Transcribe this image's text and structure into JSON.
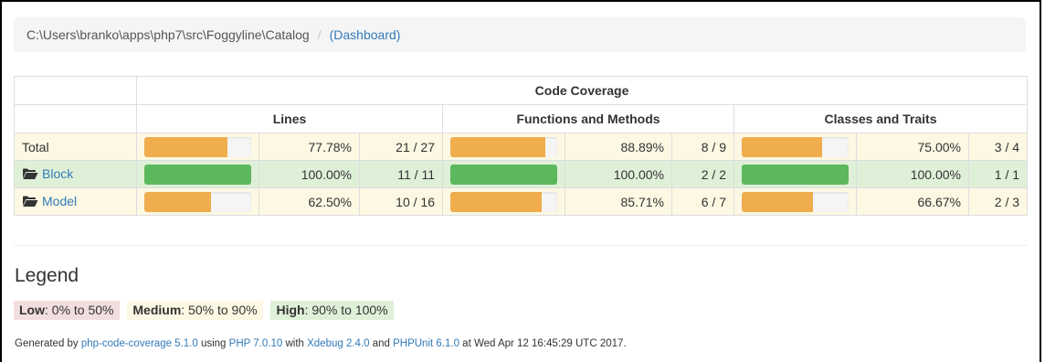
{
  "breadcrumb": {
    "path": "C:\\Users\\branko\\apps\\php7\\src\\Foggyline\\Catalog",
    "separator": "/",
    "dashboard_link": "(Dashboard)"
  },
  "table": {
    "title": "Code Coverage",
    "groups": [
      "Lines",
      "Functions and Methods",
      "Classes and Traits"
    ],
    "rows": [
      {
        "name": "Total",
        "is_link": false,
        "status": "warning",
        "lines": {
          "fraction": 0.7778,
          "percent": "77.78%",
          "count": "21 / 27",
          "level": "warning"
        },
        "functions": {
          "fraction": 0.8889,
          "percent": "88.89%",
          "count": "8 / 9",
          "level": "warning"
        },
        "classes": {
          "fraction": 0.75,
          "percent": "75.00%",
          "count": "3 / 4",
          "level": "warning"
        }
      },
      {
        "name": "Block",
        "is_link": true,
        "status": "success",
        "lines": {
          "fraction": 1.0,
          "percent": "100.00%",
          "count": "11 / 11",
          "level": "success"
        },
        "functions": {
          "fraction": 1.0,
          "percent": "100.00%",
          "count": "2 / 2",
          "level": "success"
        },
        "classes": {
          "fraction": 1.0,
          "percent": "100.00%",
          "count": "1 / 1",
          "level": "success"
        }
      },
      {
        "name": "Model",
        "is_link": true,
        "status": "warning",
        "lines": {
          "fraction": 0.625,
          "percent": "62.50%",
          "count": "10 / 16",
          "level": "warning"
        },
        "functions": {
          "fraction": 0.8571,
          "percent": "85.71%",
          "count": "6 / 7",
          "level": "warning"
        },
        "classes": {
          "fraction": 0.6667,
          "percent": "66.67%",
          "count": "2 / 3",
          "level": "warning"
        }
      }
    ]
  },
  "legend": {
    "title": "Legend",
    "low_label": "Low",
    "low_range": ": 0% to 50%",
    "medium_label": "Medium",
    "medium_range": ": 50% to 90%",
    "high_label": "High",
    "high_range": ": 90% to 100%"
  },
  "footer": {
    "generated_by": "Generated by ",
    "tool_link": "php-code-coverage 5.1.0",
    "using": " using ",
    "php_link": "PHP 7.0.10",
    "with": " with ",
    "xdebug_link": "Xdebug 2.4.0",
    "and": " and ",
    "phpunit_link": "PHPUnit 6.1.0",
    "date": " at Wed Apr 12 16:45:29 UTC 2017."
  },
  "colors": {
    "warning_bar": "#f0ad4e",
    "success_bar": "#5cb85c",
    "warning_row": "#fcf8e3",
    "success_row": "#dff0d8",
    "danger_chip": "#f2dede",
    "link": "#337ab7"
  },
  "icons": {
    "folder": "folder-open-icon"
  }
}
